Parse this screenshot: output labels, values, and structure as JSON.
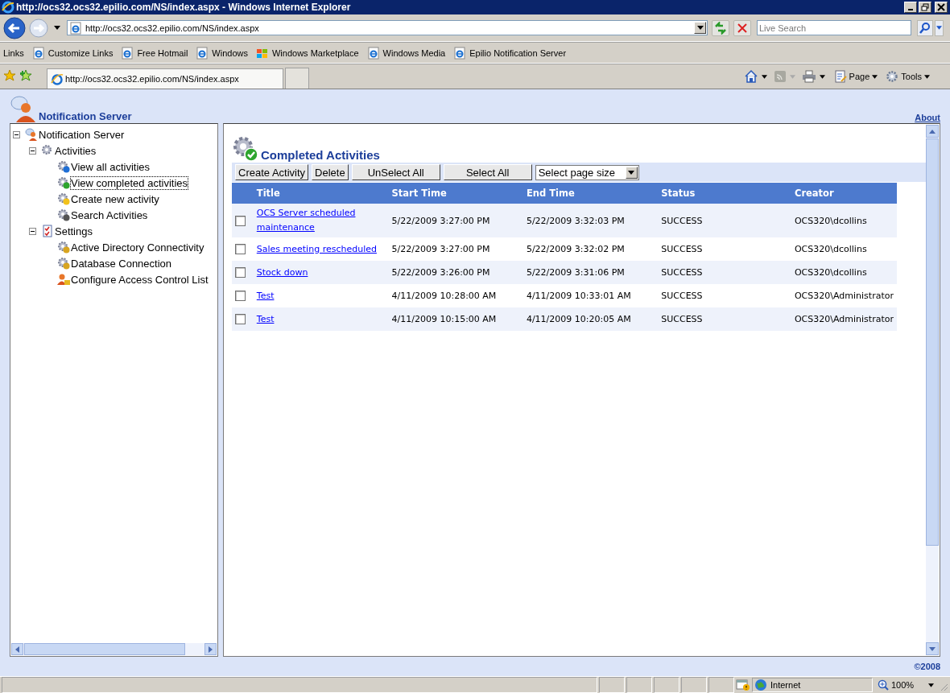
{
  "window": {
    "title": "http://ocs32.ocs32.epilio.com/NS/index.aspx - Windows Internet Explorer"
  },
  "address_bar": {
    "url": "http://ocs32.ocs32.epilio.com/NS/index.aspx"
  },
  "search": {
    "placeholder": "Live Search"
  },
  "links_bar": {
    "label": "Links",
    "items": [
      {
        "label": "Customize Links",
        "kind": "page"
      },
      {
        "label": "Free Hotmail",
        "kind": "page"
      },
      {
        "label": "Windows",
        "kind": "page"
      },
      {
        "label": "Windows Marketplace",
        "kind": "market"
      },
      {
        "label": "Windows Media",
        "kind": "page"
      },
      {
        "label": "Epilio Notification Server",
        "kind": "page"
      }
    ]
  },
  "tabs": [
    {
      "title": "http://ocs32.ocs32.epilio.com/NS/index.aspx",
      "selected": true
    }
  ],
  "command_bar": {
    "items": [
      {
        "label": "Page",
        "kind": "page"
      },
      {
        "label": "Tools",
        "kind": "tools"
      }
    ]
  },
  "page": {
    "app_title": "Notification Server",
    "about_link": "About",
    "tree": [
      {
        "label": "Notification Server",
        "kind": "server",
        "expanded": true,
        "selected": false,
        "children": [
          {
            "label": "Activities",
            "kind": "gears",
            "expanded": true,
            "selected": false,
            "children": [
              {
                "label": "View all activities",
                "kind": "info",
                "selected": false
              },
              {
                "label": "View completed activities",
                "kind": "done",
                "selected": true
              },
              {
                "label": "Create new activity",
                "kind": "new",
                "selected": false
              },
              {
                "label": "Search Activities",
                "kind": "search",
                "selected": false
              }
            ]
          },
          {
            "label": "Settings",
            "kind": "checklist",
            "expanded": true,
            "selected": false,
            "children": [
              {
                "label": "Active Directory Connectivity",
                "kind": "lock",
                "selected": false
              },
              {
                "label": "Database Connection",
                "kind": "lock",
                "selected": false
              },
              {
                "label": "Configure Access Control List",
                "kind": "acl",
                "selected": false
              }
            ]
          }
        ]
      }
    ],
    "heading": "Completed Activities",
    "buttons": [
      "Create Activity",
      "Delete",
      "UnSelect All",
      "Select All"
    ],
    "page_size_select": {
      "value": "Select page size"
    },
    "table": {
      "columns": [
        "Title",
        "Start Time",
        "End Time",
        "Status",
        "Creator"
      ],
      "rows": [
        {
          "checked": false,
          "title": "OCS Server scheduled maintenance",
          "start": "5/22/2009 3:27:00 PM",
          "end": "5/22/2009 3:32:03 PM",
          "status": "SUCCESS",
          "creator": "OCS320\\dcollins"
        },
        {
          "checked": false,
          "title": "Sales meeting rescheduled",
          "start": "5/22/2009 3:27:00 PM",
          "end": "5/22/2009 3:32:02 PM",
          "status": "SUCCESS",
          "creator": "OCS320\\dcollins"
        },
        {
          "checked": false,
          "title": "Stock down",
          "start": "5/22/2009 3:26:00 PM",
          "end": "5/22/2009 3:31:06 PM",
          "status": "SUCCESS",
          "creator": "OCS320\\dcollins"
        },
        {
          "checked": false,
          "title": "Test",
          "start": "4/11/2009 10:28:00 AM",
          "end": "4/11/2009 10:33:01 AM",
          "status": "SUCCESS",
          "creator": "OCS320\\Administrator"
        },
        {
          "checked": false,
          "title": "Test",
          "start": "4/11/2009 10:15:00 AM",
          "end": "4/11/2009 10:20:05 AM",
          "status": "SUCCESS",
          "creator": "OCS320\\Administrator"
        }
      ]
    },
    "footer": "©2008"
  },
  "status_bar": {
    "zone": "Internet",
    "zoom": "100%"
  }
}
